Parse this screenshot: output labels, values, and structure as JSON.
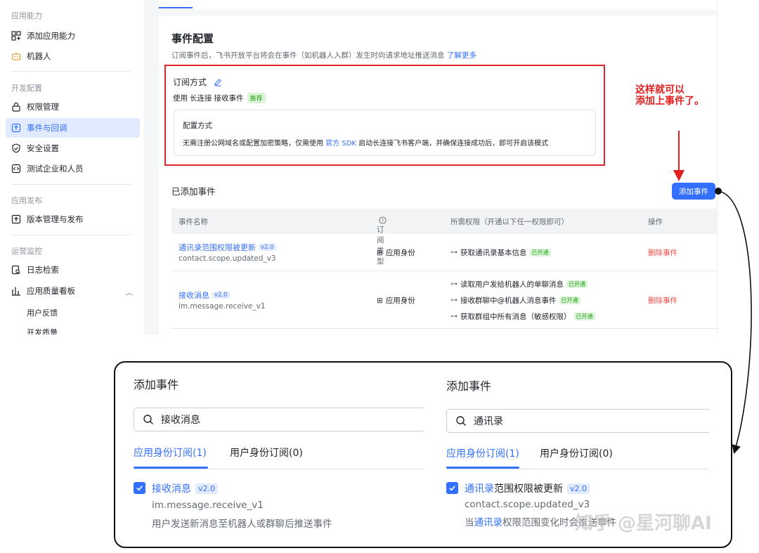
{
  "sidebar": {
    "groups": [
      "应用能力",
      "开发配置",
      "应用发布",
      "运营监控"
    ],
    "items": [
      {
        "label": "添加应用能力",
        "icon": "grid-plus-icon"
      },
      {
        "label": "机器人",
        "icon": "robot-icon"
      },
      {
        "label": "权限管理",
        "icon": "lock-icon"
      },
      {
        "label": "事件与回调",
        "icon": "event-icon",
        "active": true
      },
      {
        "label": "安全设置",
        "icon": "shield-icon"
      },
      {
        "label": "测试企业和人员",
        "icon": "code-icon"
      },
      {
        "label": "版本管理与发布",
        "icon": "upload-icon"
      },
      {
        "label": "日志检索",
        "icon": "log-search-icon"
      },
      {
        "label": "应用质量看板",
        "icon": "bar-chart-icon"
      }
    ],
    "subitems": [
      "用户反馈",
      "开发质量"
    ]
  },
  "event_config": {
    "title": "事件配置",
    "desc": "订阅事件后，飞书开放平台将会在事件（如机器人入群）发生时向请求地址推送消息",
    "learn_more": "了解更多",
    "sub_title": "订阅方式",
    "use_prefix": "使用",
    "use_mode": "长连接",
    "use_suffix": "接收事件",
    "recommend": "推荐",
    "config_title": "配置方式",
    "config_desc_1": "无需注册公网域名或配置加密策略，仅需使用",
    "config_link": "官方 SDK",
    "config_desc_2": "启动长连接飞书客户端，并确保连接成功后，即可开启该模式"
  },
  "added_events": {
    "title": "已添加事件",
    "add_button": "添加事件",
    "columns": [
      "事件名称",
      "订阅类型",
      "所需权限（开通以下任一权限即可）",
      "操作"
    ],
    "rows": [
      {
        "name": "通讯录范围权限被更新",
        "version": "v2.0",
        "key": "contact.scope.updated_v3",
        "type": "应用身份",
        "permissions": [
          {
            "text": "获取通讯录基本信息",
            "status": "已开通"
          }
        ],
        "action": "删除事件"
      },
      {
        "name": "接收消息",
        "version": "v2.0",
        "key": "im.message.receive_v1",
        "type": "应用身份",
        "permissions": [
          {
            "text": "读取用户发给机器人的单聊消息",
            "status": "已开通"
          },
          {
            "text": "接收群聊中@机器人消息事件",
            "status": "已开通"
          },
          {
            "text": "获取群组中所有消息（敏感权限）",
            "status": "已开通"
          }
        ],
        "action": "删除事件"
      }
    ]
  },
  "annotation": {
    "line1": "这样就可以",
    "line2": "添加上事件了。"
  },
  "dialogs": [
    {
      "title": "添加事件",
      "search_value": "接收消息",
      "tab_app": "应用身份订阅(1)",
      "tab_user": "用户身份订阅(0)",
      "item_name_hl": "接收消息",
      "item_name_rest": "",
      "item_version": "v2.0",
      "item_key": "im.message.receive_v1",
      "item_desc_hl": "",
      "item_desc": "用户发送新消息至机器人或群聊后推送事件"
    },
    {
      "title": "添加事件",
      "search_value": "通讯录",
      "tab_app": "应用身份订阅(1)",
      "tab_user": "用户身份订阅(0)",
      "item_name_hl": "通讯录",
      "item_name_rest": "范围权限被更新",
      "item_version": "v2.0",
      "item_key": "contact.scope.updated_v3",
      "item_desc_prefix": "当",
      "item_desc_hl": "通讯录",
      "item_desc": "权限范围变化时会推送事件"
    }
  ],
  "watermark": "知乎 @星河聊AI",
  "colors": {
    "accent": "#3370ff",
    "annotation_red": "#e02020",
    "danger": "#f54a45",
    "success": "#2ea121"
  }
}
